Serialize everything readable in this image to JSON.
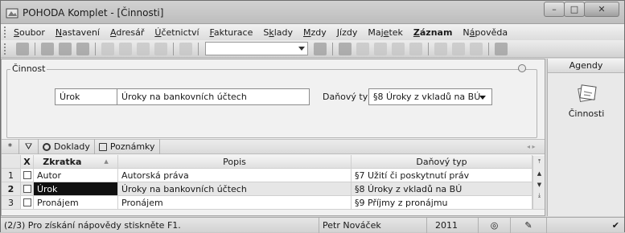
{
  "window": {
    "title": "POHODA Komplet - [Činnosti]"
  },
  "menu": [
    {
      "u": "S",
      "rest": "oubor",
      "bold": false
    },
    {
      "u": "N",
      "rest": "astavení",
      "bold": false
    },
    {
      "u": "A",
      "rest": "dresář",
      "bold": false
    },
    {
      "u": "Ú",
      "rest": "četnictví",
      "bold": false
    },
    {
      "u": "F",
      "rest": "akturace",
      "bold": false
    },
    {
      "pre": "S",
      "u": "k",
      "rest": "lady",
      "bold": false
    },
    {
      "u": "M",
      "rest": "zdy",
      "bold": false
    },
    {
      "u": "J",
      "rest": "ízdy",
      "bold": false
    },
    {
      "pre": "Maj",
      "u": "e",
      "rest": "tek",
      "bold": false
    },
    {
      "u": "Z",
      "rest": "áznam",
      "bold": true
    },
    {
      "pre": "N",
      "u": "á",
      "rest": "pověda",
      "bold": false
    }
  ],
  "form": {
    "group_title": "Činnost",
    "zkratka_value": "Úrok",
    "popis_value": "Úroky na bankovních účtech",
    "danovy_typ_label": "Daňový typ",
    "danovy_typ_value": "§8  Úroky z vkladů na BÚ"
  },
  "tabs": {
    "star": "*",
    "doklady": "Doklady",
    "poznamky": "Poznámky"
  },
  "grid": {
    "headers": {
      "x": "X",
      "zkratka": "Zkratka",
      "popis": "Popis",
      "danovy_typ": "Daňový typ"
    },
    "rows": [
      {
        "num": "1",
        "zkratka": "Autor",
        "popis": "Autorská práva",
        "danovy_typ": "§7  Užití či poskytnutí práv"
      },
      {
        "num": "2",
        "zkratka": "Úrok",
        "popis": "Úroky na bankovních účtech",
        "danovy_typ": "§8  Úroky z vkladů na BÚ"
      },
      {
        "num": "3",
        "zkratka": "Pronájem",
        "popis": "Pronájem",
        "danovy_typ": "§9  Příjmy z pronájmu"
      }
    ]
  },
  "right_panel": {
    "header": "Agendy",
    "item": "Činnosti"
  },
  "status": {
    "help": "(2/3) Pro získání nápovědy stiskněte F1.",
    "user": "Petr Nováček",
    "year": "2011"
  }
}
